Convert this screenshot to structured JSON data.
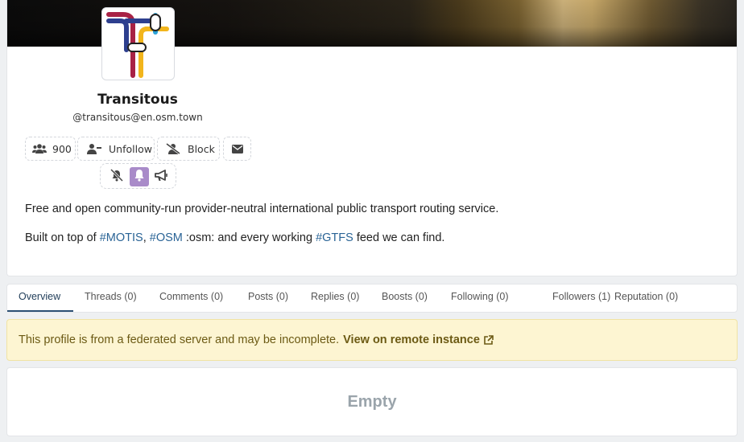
{
  "profile": {
    "name": "Transitous",
    "handle": "@transitous@en.osm.town",
    "followers_count": "900",
    "unfollow_label": "Unfollow",
    "block_label": "Block",
    "bio_line1": "Free and open community-run provider-neutral international public transport routing service.",
    "bio_line2": {
      "prefix": "Built on top of ",
      "tag1": "#MOTIS",
      "sep1": ", ",
      "tag2": "#OSM",
      "mid": " :osm: and every working ",
      "tag3": "#GTFS",
      "suffix": " feed we can find."
    }
  },
  "tabs": [
    {
      "label": "Overview",
      "active": true
    },
    {
      "label": "Threads (0)"
    },
    {
      "label": "Comments (0)"
    },
    {
      "label": "Posts (0)"
    },
    {
      "label": "Replies (0)"
    },
    {
      "label": "Boosts (0)"
    },
    {
      "label": "Following (0)"
    },
    {
      "label": "Followers (1)"
    },
    {
      "label": "Reputation (0)"
    }
  ],
  "alert": {
    "message": "This profile is from a federated server and may be incomplete.",
    "link_label": "View on remote instance"
  },
  "empty_label": "Empty",
  "colors": {
    "accent": "#2b4f73",
    "bell_active": "#a98bc9",
    "alert_bg": "#fdf5d2",
    "tag_link": "#2a6496"
  },
  "icons": [
    "users-icon",
    "user-minus-icon",
    "user-slash-icon",
    "envelope-icon",
    "bell-slash-icon",
    "bell-icon",
    "megaphone-icon",
    "external-link-icon"
  ]
}
